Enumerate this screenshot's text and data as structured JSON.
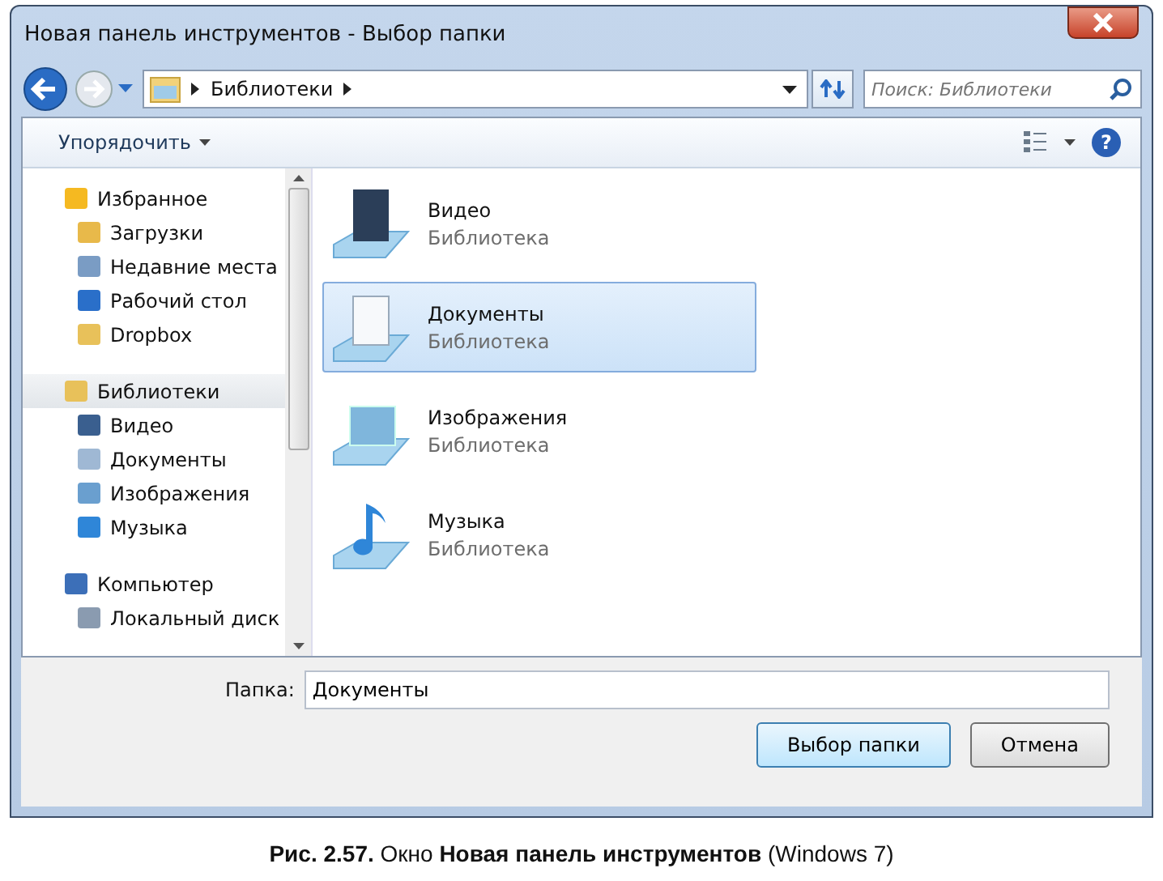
{
  "window": {
    "title": "Новая панель инструментов - Выбор папки"
  },
  "address_bar": {
    "path": [
      "Библиотеки"
    ],
    "search": {
      "placeholder": "Поиск: Библиотеки"
    }
  },
  "toolbar": {
    "organize": "Упорядочить",
    "help": "?"
  },
  "sidebar": {
    "groups": [
      {
        "label": "Избранное",
        "selected": false,
        "children": [
          {
            "label": "Загрузки",
            "selected": false
          },
          {
            "label": "Недавние места",
            "selected": false
          },
          {
            "label": "Рабочий стол",
            "selected": false
          },
          {
            "label": "Dropbox",
            "selected": false
          }
        ]
      },
      {
        "label": "Библиотеки",
        "selected": true,
        "children": [
          {
            "label": "Видео",
            "selected": false
          },
          {
            "label": "Документы",
            "selected": false
          },
          {
            "label": "Изображения",
            "selected": false
          },
          {
            "label": "Музыка",
            "selected": false
          }
        ]
      },
      {
        "label": "Компьютер",
        "selected": false,
        "children": [
          {
            "label": "Локальный диск",
            "selected": false
          }
        ]
      }
    ]
  },
  "libraries": [
    {
      "name": "Видео",
      "type": "Библиотека",
      "selected": false
    },
    {
      "name": "Документы",
      "type": "Библиотека",
      "selected": true
    },
    {
      "name": "Изображения",
      "type": "Библиотека",
      "selected": false
    },
    {
      "name": "Музыка",
      "type": "Библиотека",
      "selected": false
    }
  ],
  "folder_field": {
    "label": "Папка:",
    "value": "Документы"
  },
  "buttons": [
    {
      "label": "Выбор папки",
      "default": true
    },
    {
      "label": "Отмена",
      "default": false
    }
  ],
  "caption": "**Рис. 2.57.** Окно **Новая панель инструментов** (Windows 7)"
}
